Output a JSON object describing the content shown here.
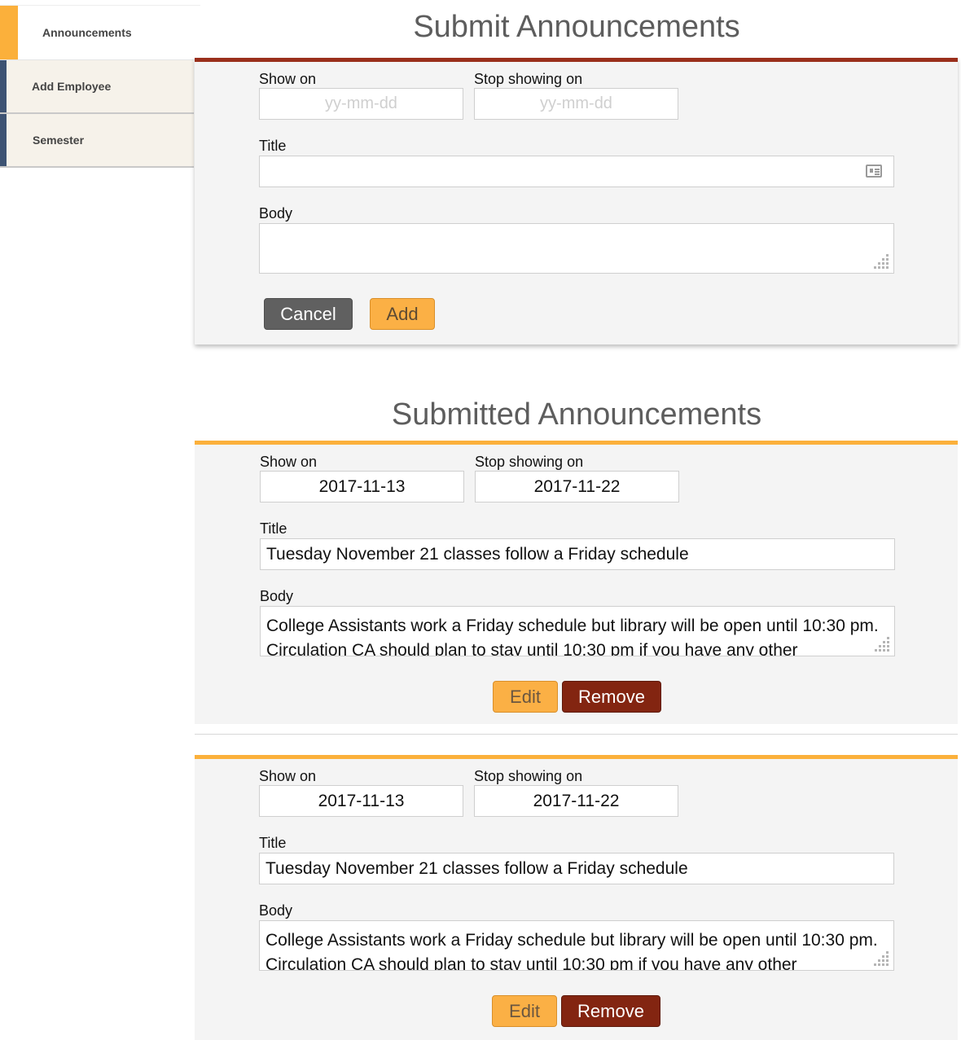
{
  "sidebar": {
    "items": [
      {
        "label": "Announcements"
      },
      {
        "label": "Add Employee"
      },
      {
        "label": "Semester"
      }
    ]
  },
  "submit": {
    "heading": "Submit Announcements",
    "show_on_label": "Show on",
    "stop_label": "Stop showing on",
    "show_on_placeholder": "yy-mm-dd",
    "stop_placeholder": "yy-mm-dd",
    "title_label": "Title",
    "title_value": "",
    "body_label": "Body",
    "body_value": "",
    "cancel_label": "Cancel",
    "add_label": "Add"
  },
  "submitted": {
    "heading": "Submitted Announcements",
    "items": [
      {
        "show_on_label": "Show on",
        "stop_label": "Stop showing on",
        "show_on": "2017-11-13",
        "stop": "2017-11-22",
        "title_label": "Title",
        "title": "Tuesday November 21 classes follow a Friday schedule",
        "body_label": "Body",
        "body_line1": "College Assistants work a Friday schedule but library will be open until 10:30 pm.",
        "body_line2": "Circulation CA should plan to stay until 10:30 pm if you have any other",
        "edit_label": "Edit",
        "remove_label": "Remove"
      },
      {
        "show_on_label": "Show on",
        "stop_label": "Stop showing on",
        "show_on": "2017-11-13",
        "stop": "2017-11-22",
        "title_label": "Title",
        "title": "Tuesday November 21 classes follow a Friday schedule",
        "body_label": "Body",
        "body_line1": "College Assistants work a Friday schedule but library will be open until 10:30 pm.",
        "body_line2": "Circulation CA should plan to stay until 10:30 pm if you have any other",
        "edit_label": "Edit",
        "remove_label": "Remove"
      }
    ]
  },
  "colors": {
    "accent_orange": "#fbb03b",
    "submit_border": "#9a2f1b",
    "remove_button": "#832511",
    "sidebar_accent": "#3d5373"
  }
}
